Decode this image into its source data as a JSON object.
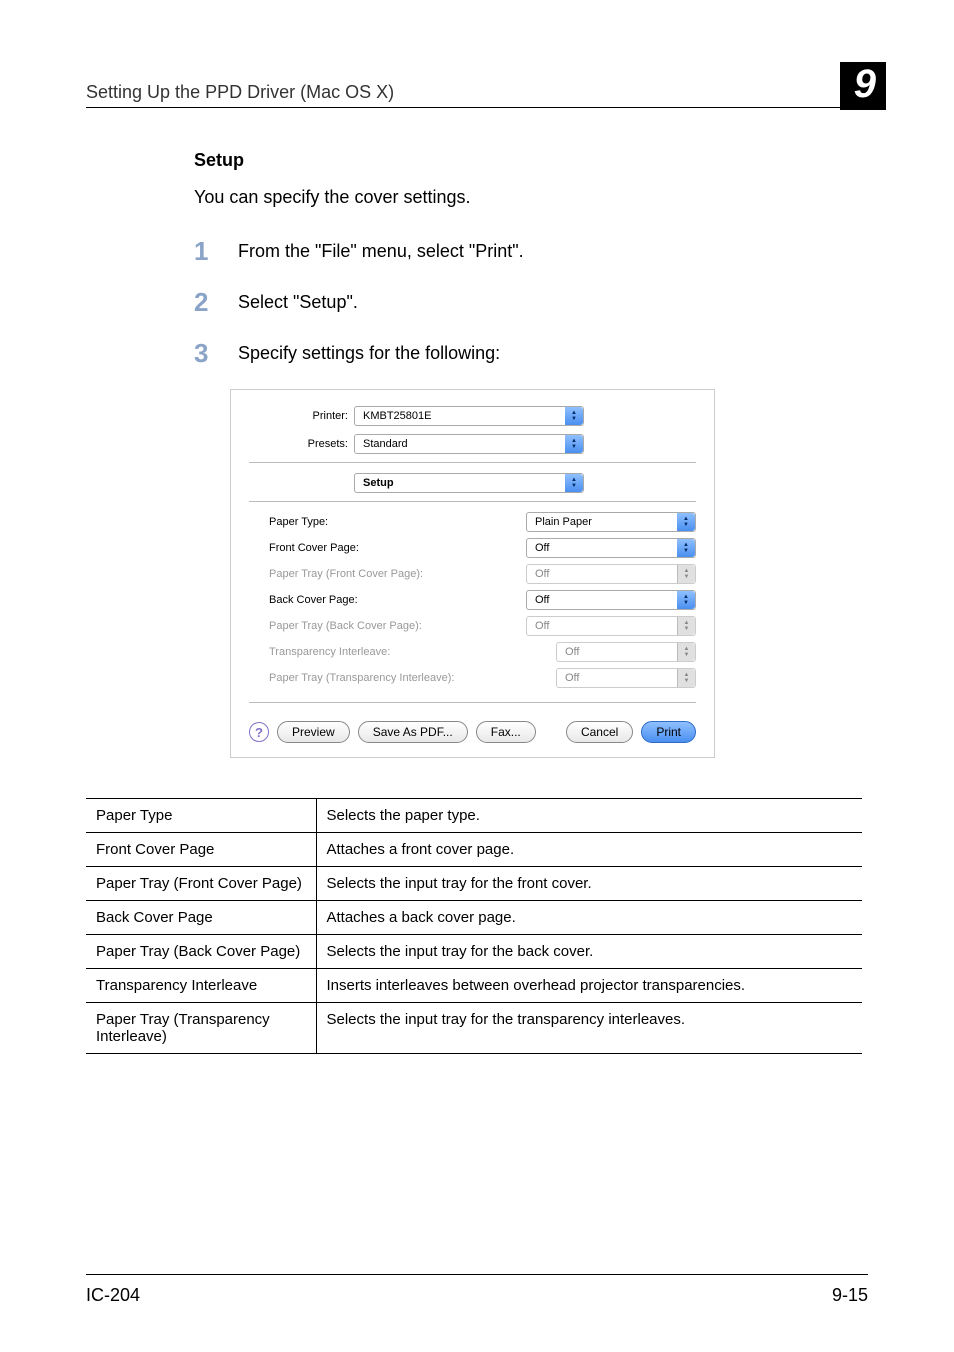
{
  "header": {
    "title": "Setting Up the PPD Driver (Mac OS X)",
    "chapter": "9"
  },
  "body": {
    "heading": "Setup",
    "intro": "You can specify the cover settings.",
    "steps": [
      {
        "num": "1",
        "text": "From the \"File\" menu, select \"Print\"."
      },
      {
        "num": "2",
        "text": "Select \"Setup\"."
      },
      {
        "num": "3",
        "text": "Specify settings for the following:"
      }
    ]
  },
  "dialog": {
    "printer_label": "Printer:",
    "printer_value": "KMBT25801E",
    "presets_label": "Presets:",
    "presets_value": "Standard",
    "pane_value": "Setup",
    "rows": {
      "paper_type": {
        "label": "Paper Type:",
        "value": "Plain Paper"
      },
      "front_cover": {
        "label": "Front Cover Page:",
        "value": "Off"
      },
      "tray_front": {
        "label": "Paper Tray (Front Cover Page):",
        "value": "Off"
      },
      "back_cover": {
        "label": "Back Cover Page:",
        "value": "Off"
      },
      "tray_back": {
        "label": "Paper Tray (Back Cover Page):",
        "value": "Off"
      },
      "transparency": {
        "label": "Transparency Interleave:",
        "value": "Off"
      },
      "tray_trans": {
        "label": "Paper Tray (Transparency Interleave):",
        "value": "Off"
      }
    },
    "buttons": {
      "help": "?",
      "preview": "Preview",
      "save_pdf": "Save As PDF...",
      "fax": "Fax...",
      "cancel": "Cancel",
      "print": "Print"
    }
  },
  "table": {
    "rows": [
      {
        "term": "Paper Type",
        "desc": "Selects the paper type."
      },
      {
        "term": "Front Cover Page",
        "desc": "Attaches a front cover page."
      },
      {
        "term": "Paper Tray (Front Cover Page)",
        "desc": "Selects the input tray for the front cover."
      },
      {
        "term": "Back Cover Page",
        "desc": "Attaches a back cover page."
      },
      {
        "term": "Paper Tray (Back Cover Page)",
        "desc": "Selects the input tray for the back cover."
      },
      {
        "term": "Transparency Interleave",
        "desc": "Inserts interleaves between overhead projector transparencies."
      },
      {
        "term": "Paper Tray (Transparency Interleave)",
        "desc": "Selects the input tray for the transparency interleaves."
      }
    ]
  },
  "footer": {
    "left": "IC-204",
    "right": "9-15"
  }
}
